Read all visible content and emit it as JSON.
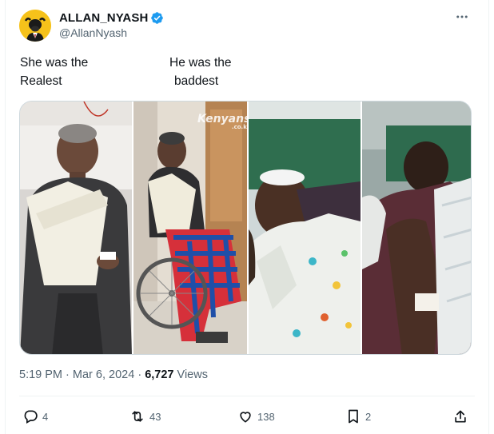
{
  "author": {
    "display_name": "ALLAN_NYASH",
    "handle": "@AllanNyash",
    "verified": true,
    "avatar_icon": "bull-avatar-icon"
  },
  "tweet": {
    "left_text_line1": "She was the",
    "left_text_line2": "Realest",
    "right_text_line1": "He was the",
    "right_text_line2": "baddest"
  },
  "media": {
    "watermark": "Kenyans",
    "watermark_suffix": ".co.ke",
    "photos": [
      "woman-in-hospital-bed-photo",
      "woman-in-wheelchair-photo",
      "man-in-hospital-bed-photo",
      "man-lying-in-bed-photo"
    ]
  },
  "meta": {
    "time": "5:19 PM",
    "separator1": "·",
    "date": "Mar 6, 2024",
    "separator2": "·",
    "views_count": "6,727",
    "views_label": "Views"
  },
  "actions": {
    "replies": "4",
    "reposts": "43",
    "likes": "138",
    "bookmarks": "2"
  },
  "colors": {
    "text_primary": "#0f1419",
    "text_secondary": "#536471",
    "verified": "#1d9bf0",
    "divider": "#eff3f4",
    "avatar_bg": "#f6c21a"
  }
}
